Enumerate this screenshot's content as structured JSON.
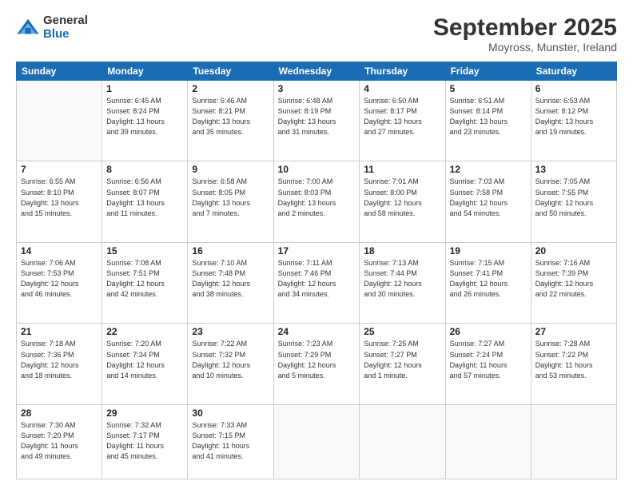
{
  "logo": {
    "general": "General",
    "blue": "Blue"
  },
  "title": "September 2025",
  "subtitle": "Moyross, Munster, Ireland",
  "days": [
    "Sunday",
    "Monday",
    "Tuesday",
    "Wednesday",
    "Thursday",
    "Friday",
    "Saturday"
  ],
  "weeks": [
    [
      {
        "day": "",
        "info": ""
      },
      {
        "day": "1",
        "info": "Sunrise: 6:45 AM\nSunset: 8:24 PM\nDaylight: 13 hours\nand 39 minutes."
      },
      {
        "day": "2",
        "info": "Sunrise: 6:46 AM\nSunset: 8:21 PM\nDaylight: 13 hours\nand 35 minutes."
      },
      {
        "day": "3",
        "info": "Sunrise: 6:48 AM\nSunset: 8:19 PM\nDaylight: 13 hours\nand 31 minutes."
      },
      {
        "day": "4",
        "info": "Sunrise: 6:50 AM\nSunset: 8:17 PM\nDaylight: 13 hours\nand 27 minutes."
      },
      {
        "day": "5",
        "info": "Sunrise: 6:51 AM\nSunset: 8:14 PM\nDaylight: 13 hours\nand 23 minutes."
      },
      {
        "day": "6",
        "info": "Sunrise: 6:53 AM\nSunset: 8:12 PM\nDaylight: 13 hours\nand 19 minutes."
      }
    ],
    [
      {
        "day": "7",
        "info": "Sunrise: 6:55 AM\nSunset: 8:10 PM\nDaylight: 13 hours\nand 15 minutes."
      },
      {
        "day": "8",
        "info": "Sunrise: 6:56 AM\nSunset: 8:07 PM\nDaylight: 13 hours\nand 11 minutes."
      },
      {
        "day": "9",
        "info": "Sunrise: 6:58 AM\nSunset: 8:05 PM\nDaylight: 13 hours\nand 7 minutes."
      },
      {
        "day": "10",
        "info": "Sunrise: 7:00 AM\nSunset: 8:03 PM\nDaylight: 13 hours\nand 2 minutes."
      },
      {
        "day": "11",
        "info": "Sunrise: 7:01 AM\nSunset: 8:00 PM\nDaylight: 12 hours\nand 58 minutes."
      },
      {
        "day": "12",
        "info": "Sunrise: 7:03 AM\nSunset: 7:58 PM\nDaylight: 12 hours\nand 54 minutes."
      },
      {
        "day": "13",
        "info": "Sunrise: 7:05 AM\nSunset: 7:55 PM\nDaylight: 12 hours\nand 50 minutes."
      }
    ],
    [
      {
        "day": "14",
        "info": "Sunrise: 7:06 AM\nSunset: 7:53 PM\nDaylight: 12 hours\nand 46 minutes."
      },
      {
        "day": "15",
        "info": "Sunrise: 7:08 AM\nSunset: 7:51 PM\nDaylight: 12 hours\nand 42 minutes."
      },
      {
        "day": "16",
        "info": "Sunrise: 7:10 AM\nSunset: 7:48 PM\nDaylight: 12 hours\nand 38 minutes."
      },
      {
        "day": "17",
        "info": "Sunrise: 7:11 AM\nSunset: 7:46 PM\nDaylight: 12 hours\nand 34 minutes."
      },
      {
        "day": "18",
        "info": "Sunrise: 7:13 AM\nSunset: 7:44 PM\nDaylight: 12 hours\nand 30 minutes."
      },
      {
        "day": "19",
        "info": "Sunrise: 7:15 AM\nSunset: 7:41 PM\nDaylight: 12 hours\nand 26 minutes."
      },
      {
        "day": "20",
        "info": "Sunrise: 7:16 AM\nSunset: 7:39 PM\nDaylight: 12 hours\nand 22 minutes."
      }
    ],
    [
      {
        "day": "21",
        "info": "Sunrise: 7:18 AM\nSunset: 7:36 PM\nDaylight: 12 hours\nand 18 minutes."
      },
      {
        "day": "22",
        "info": "Sunrise: 7:20 AM\nSunset: 7:34 PM\nDaylight: 12 hours\nand 14 minutes."
      },
      {
        "day": "23",
        "info": "Sunrise: 7:22 AM\nSunset: 7:32 PM\nDaylight: 12 hours\nand 10 minutes."
      },
      {
        "day": "24",
        "info": "Sunrise: 7:23 AM\nSunset: 7:29 PM\nDaylight: 12 hours\nand 5 minutes."
      },
      {
        "day": "25",
        "info": "Sunrise: 7:25 AM\nSunset: 7:27 PM\nDaylight: 12 hours\nand 1 minute."
      },
      {
        "day": "26",
        "info": "Sunrise: 7:27 AM\nSunset: 7:24 PM\nDaylight: 11 hours\nand 57 minutes."
      },
      {
        "day": "27",
        "info": "Sunrise: 7:28 AM\nSunset: 7:22 PM\nDaylight: 11 hours\nand 53 minutes."
      }
    ],
    [
      {
        "day": "28",
        "info": "Sunrise: 7:30 AM\nSunset: 7:20 PM\nDaylight: 11 hours\nand 49 minutes."
      },
      {
        "day": "29",
        "info": "Sunrise: 7:32 AM\nSunset: 7:17 PM\nDaylight: 11 hours\nand 45 minutes."
      },
      {
        "day": "30",
        "info": "Sunrise: 7:33 AM\nSunset: 7:15 PM\nDaylight: 11 hours\nand 41 minutes."
      },
      {
        "day": "",
        "info": ""
      },
      {
        "day": "",
        "info": ""
      },
      {
        "day": "",
        "info": ""
      },
      {
        "day": "",
        "info": ""
      }
    ]
  ]
}
